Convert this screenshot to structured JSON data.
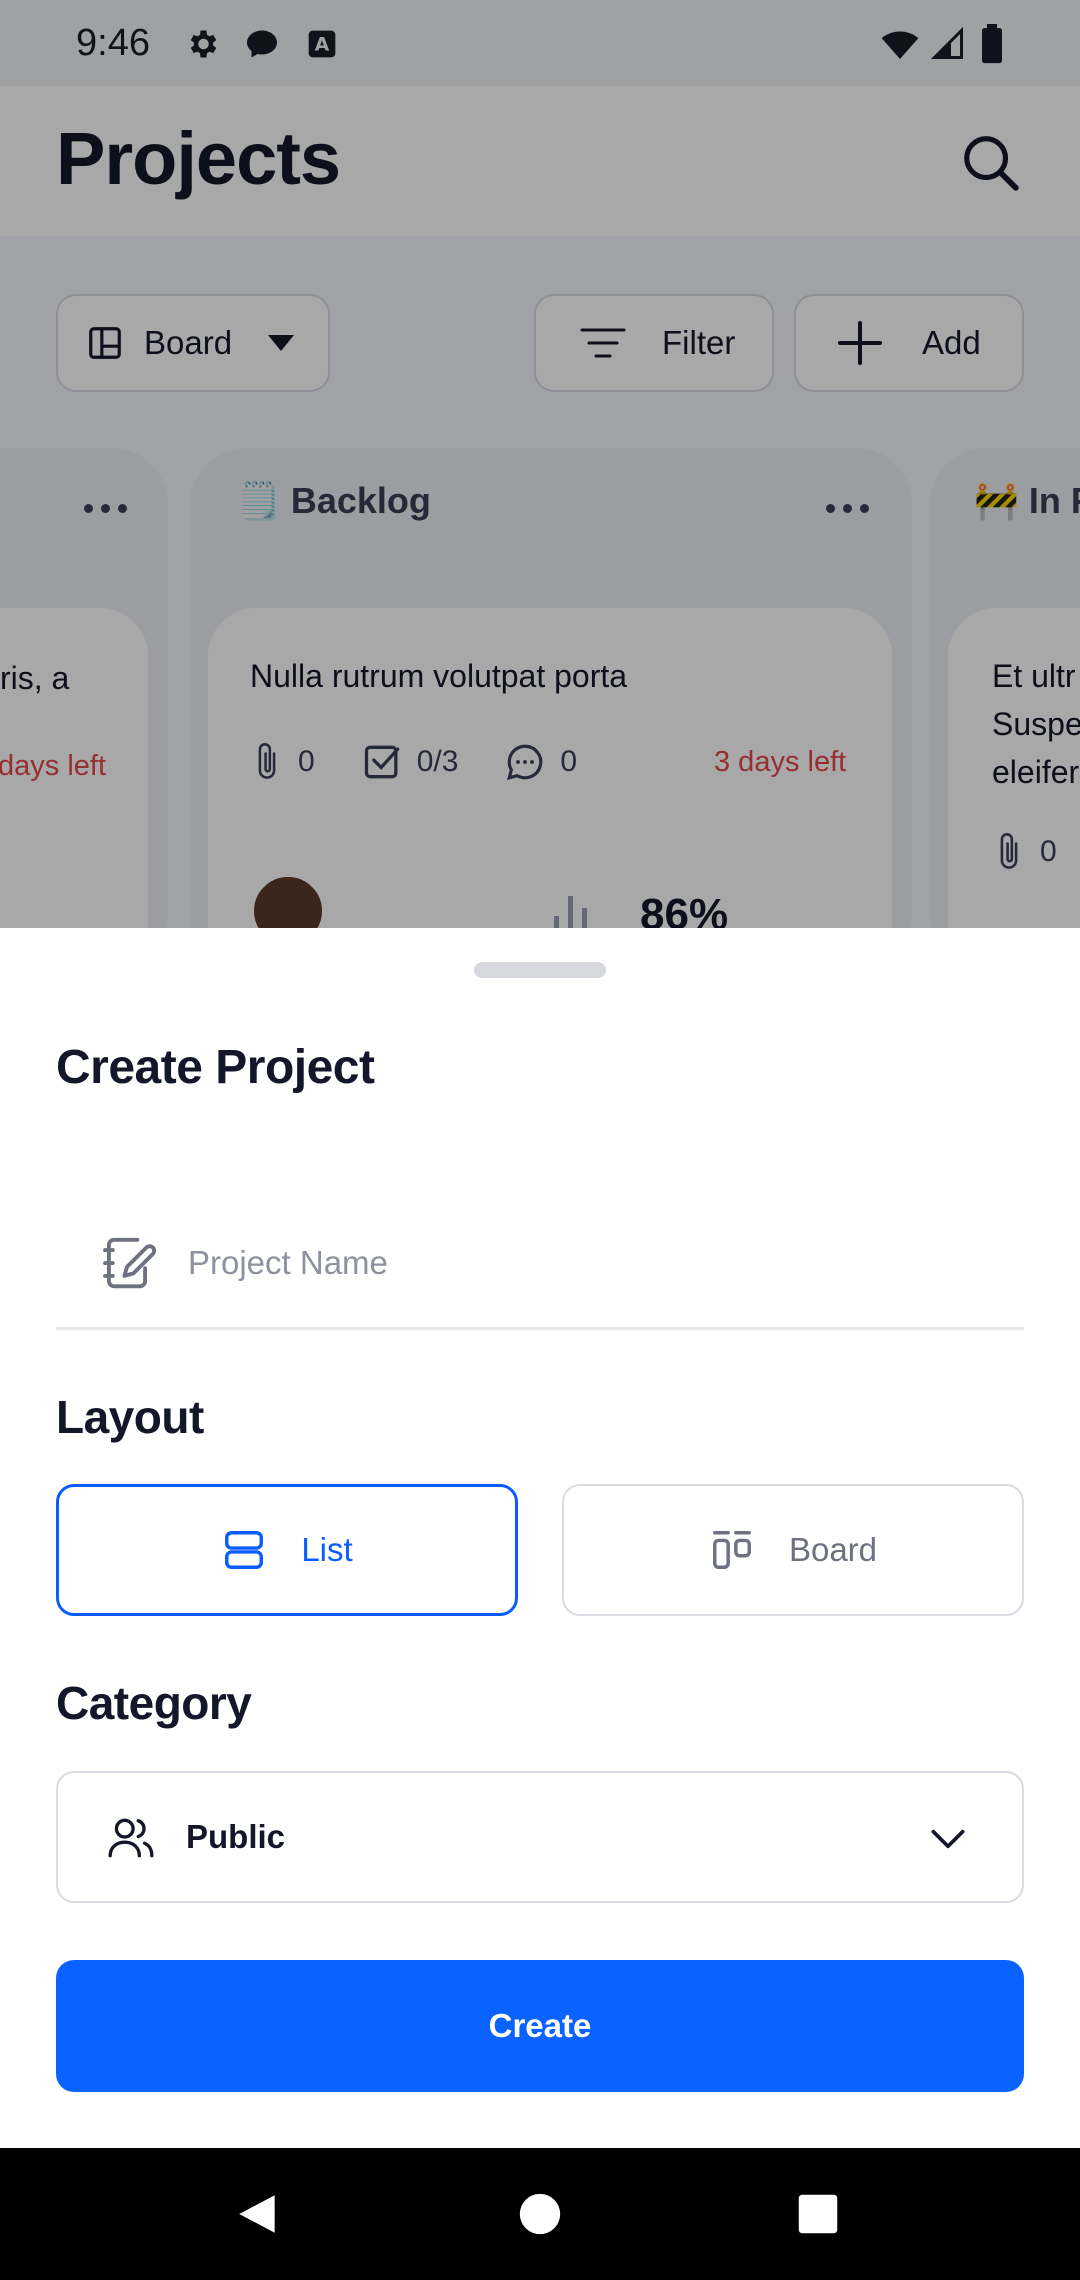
{
  "status_bar": {
    "time": "9:46"
  },
  "app": {
    "title": "Projects",
    "toolbar": {
      "view_label": "Board",
      "filter_label": "Filter",
      "add_label": "Add"
    },
    "columns": [
      {
        "name": "",
        "card": {
          "title": "ris, a",
          "days_left": "days left"
        }
      },
      {
        "name": "Backlog",
        "emoji": "🗒️",
        "card": {
          "title": "Nulla rutrum volutpat porta",
          "attachments": "0",
          "checklist": "0/3",
          "comments": "0",
          "days_left": "3 days left",
          "progress": "86%"
        }
      },
      {
        "name": "In P",
        "emoji": "🚧",
        "card": {
          "title_lines": [
            "Et ultr",
            "Suspe",
            "eleifer"
          ],
          "attachments": "0"
        }
      }
    ]
  },
  "sheet": {
    "title": "Create Project",
    "name_placeholder": "Project Name",
    "layout_label": "Layout",
    "layout_options": [
      {
        "label": "List",
        "selected": true
      },
      {
        "label": "Board",
        "selected": false
      }
    ],
    "category_label": "Category",
    "category_value": "Public",
    "create_label": "Create"
  },
  "colors": {
    "primary": "#0a63ff",
    "danger": "#e5484d",
    "text": "#14172a"
  }
}
